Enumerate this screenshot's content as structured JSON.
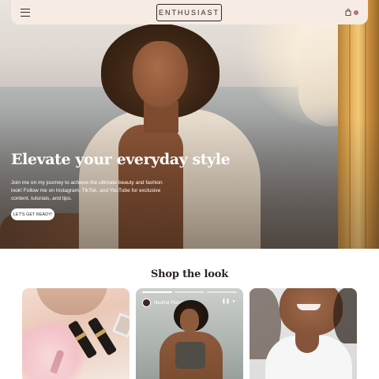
{
  "nav": {
    "brand": "ENTHUSIAST",
    "menu_icon": "hamburger-menu-icon",
    "bag_icon": "shopping-bag-icon",
    "cart_indicator_color": "#b5727a"
  },
  "hero": {
    "title": "Elevate your everyday style",
    "body": "Join me on my journey to achieve the ultimate beauty and fashion look! Follow me on Instagram, TikTok, and YouTube for exclusive content, tutorials, and tips.",
    "cta_label": "LET'S GET READY!"
  },
  "shop": {
    "title": "Shop the look",
    "cards": [
      {
        "name": "lipstick-flatlay"
      },
      {
        "name": "fitness-story",
        "story_name": "Neutral Pieces"
      },
      {
        "name": "smiling-model"
      }
    ]
  },
  "colors": {
    "nav_bg": "#f7ece3",
    "text": "#2b2523",
    "accent": "#b5727a"
  }
}
